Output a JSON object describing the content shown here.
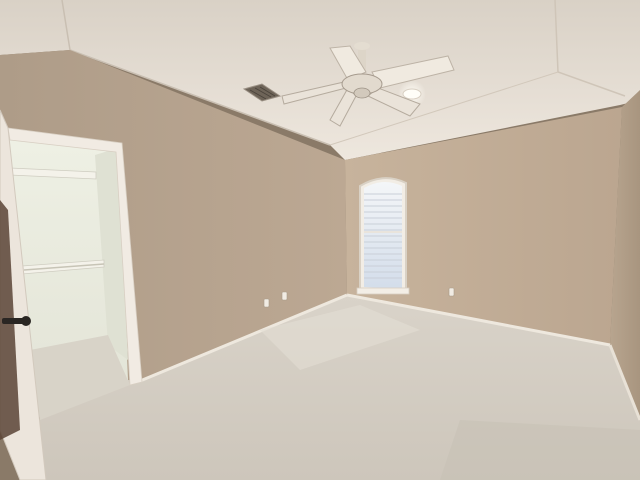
{
  "scene": {
    "subject": "empty bedroom",
    "colors": {
      "ceiling": "#e6ddd3",
      "wall_left": "#bba994",
      "wall_back": "#c2ad94",
      "wall_right": "#b5a28d",
      "carpet": "#d6d0c6",
      "trim": "#f1ebe3",
      "door": "#ece5dc",
      "closet_interior": "#e7e9dc",
      "window_light": "#dfe7f2"
    },
    "icons": [
      "ceiling-fan-icon",
      "window-blinds-icon",
      "closet-door-icon",
      "hvac-vent-icon",
      "recessed-light-icon",
      "wall-outlet-icon"
    ]
  }
}
